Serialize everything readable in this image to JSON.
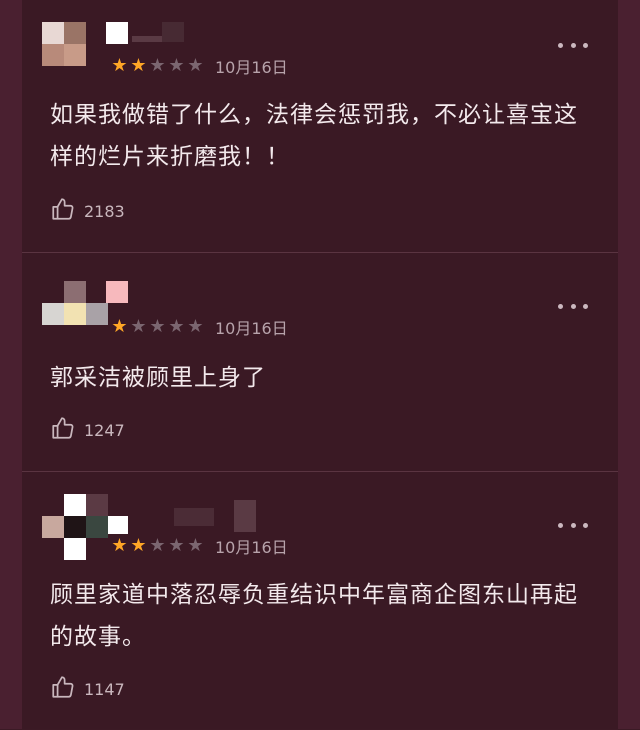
{
  "reviews": [
    {
      "rating": 2,
      "max_rating": 5,
      "date": "10月16日",
      "text": "如果我做错了什么，法律会惩罚我，不必让喜宝这样的烂片来折磨我！！",
      "likes": "2183"
    },
    {
      "rating": 1,
      "max_rating": 5,
      "date": "10月16日",
      "text": "郭采洁被顾里上身了",
      "likes": "1247"
    },
    {
      "rating": 2,
      "max_rating": 5,
      "date": "10月16日",
      "text": "顾里家道中落忍辱负重结识中年富商企图东山再起的故事。",
      "likes": "1147"
    }
  ],
  "icons": {
    "more": "more-horizontal-icon",
    "like": "thumbs-up-icon",
    "star": "star-icon"
  },
  "colors": {
    "background": "#3b1a25",
    "star_active": "#ffa726",
    "star_inactive": "#7b6670"
  }
}
